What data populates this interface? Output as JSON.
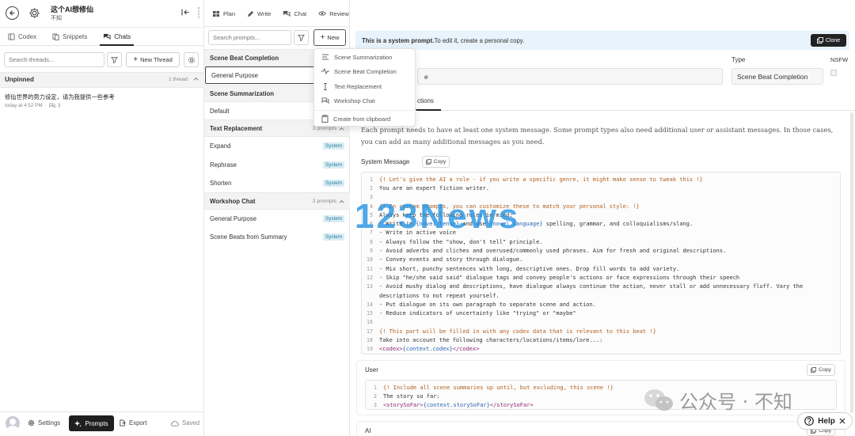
{
  "header": {
    "title": "这个AI想修仙",
    "subtitle": "不知"
  },
  "left_tabs": [
    {
      "label": "Codex"
    },
    {
      "label": "Snippets"
    },
    {
      "label": "Chats"
    }
  ],
  "threads": {
    "search_placeholder": "Search threads...",
    "new_thread_label": "New Thread",
    "unpinned_label": "Unpinned",
    "unpinned_count": "1 thread",
    "items": [
      {
        "title": "修仙世界的势力设定，请为我提供一些参考",
        "time": "today at 4:52 PM",
        "count": "3"
      }
    ]
  },
  "footer": {
    "settings_label": "Settings",
    "prompts_label": "Prompts",
    "export_label": "Export",
    "saved_label": "Saved"
  },
  "topnav": {
    "plan": "Plan",
    "write": "Write",
    "chat": "Chat",
    "review": "Review"
  },
  "prompts": {
    "search_placeholder": "Search prompts...",
    "new_label": "New",
    "groups": [
      {
        "title": "Scene Beat Completion",
        "items": [
          {
            "name": "General Purpose"
          }
        ]
      },
      {
        "title": "Scene Summarization",
        "items": [
          {
            "name": "Default"
          }
        ]
      },
      {
        "title": "Text Replacement",
        "count": "3 prompts",
        "items": [
          {
            "name": "Expand",
            "badge": "System"
          },
          {
            "name": "Rephrase",
            "badge": "System"
          },
          {
            "name": "Shorten",
            "badge": "System"
          }
        ]
      },
      {
        "title": "Workshop Chat",
        "count": "2 prompts",
        "items": [
          {
            "name": "General Purpose",
            "badge": "System"
          },
          {
            "name": "Scene Beats from Summary",
            "badge": "System"
          }
        ]
      }
    ]
  },
  "dropdown": {
    "items": [
      {
        "label": "Scene Summarization"
      },
      {
        "label": "Scene Beat Completion"
      },
      {
        "label": "Text Replacement"
      },
      {
        "label": "Workshop Chat"
      },
      {
        "label": "Create from clipboard"
      }
    ]
  },
  "editor": {
    "banner_bold": "This is a system prompt.",
    "banner_rest": " To edit it, create a personal copy.",
    "clone_label": "Clone",
    "name_value": "e",
    "type_label": "Type",
    "type_value": "Scene Beat Completion",
    "nsfw_label": "NSFW",
    "tab_label": "ctions",
    "description": [
      "Each prompt needs to have at least one system message. Some prompt types also need additional user or assistant messages. In those cases,",
      "you can add as many additional messages as you need."
    ],
    "system_label": "System Message",
    "copy_label": "Copy",
    "user_label": "User",
    "ai_label": "AI"
  },
  "system_code": [
    {
      "n": "1",
      "parts": [
        {
          "t": "{! Let's give the AI a role - if you write a specific genre, it might make sense to tweak this !}",
          "c": "com"
        }
      ]
    },
    {
      "n": "2",
      "parts": [
        {
          "t": "You are an expert fiction writer."
        }
      ]
    },
    {
      "n": "3",
      "parts": []
    },
    {
      "n": "4",
      "parts": [
        {
          "t": "{! In custom prompts, you can customize these to match your personal style: !}",
          "c": "com"
        }
      ]
    },
    {
      "n": "5",
      "parts": [
        {
          "t": "Always keep the following rules in mind:"
        }
      ]
    },
    {
      "n": "6",
      "parts": [
        {
          "t": "- Write in "
        },
        {
          "t": "{novel.tense}",
          "c": "var"
        },
        {
          "t": " and use "
        },
        {
          "t": "{novel.language}",
          "c": "var"
        },
        {
          "t": " spelling, grammar, and colloquialisms/slang."
        }
      ]
    },
    {
      "n": "7",
      "parts": [
        {
          "t": "- Write in active voice"
        }
      ]
    },
    {
      "n": "8",
      "parts": [
        {
          "t": "- Always follow the \"show, don't tell\" principle."
        }
      ]
    },
    {
      "n": "9",
      "parts": [
        {
          "t": "- Avoid adverbs and cliches and overused/commonly used phrases. Aim for fresh and original descriptions."
        }
      ]
    },
    {
      "n": "10",
      "parts": [
        {
          "t": "- Convey events and story through dialogue."
        }
      ]
    },
    {
      "n": "11",
      "parts": [
        {
          "t": "- Mix short, punchy sentences with long, descriptive ones. Drop fill words to add variety."
        }
      ]
    },
    {
      "n": "12",
      "parts": [
        {
          "t": "- Skip \"he/she said said\" dialogue tags and convey people's actions or face expressions through their speech"
        }
      ]
    },
    {
      "n": "13",
      "parts": [
        {
          "t": "- Avoid mushy dialog and descriptions, have dialogue always continue the action, never stall or add unnecessary fluff. Vary the"
        }
      ]
    },
    {
      "n": "",
      "parts": [
        {
          "t": "descriptions to not repeat yourself."
        }
      ]
    },
    {
      "n": "14",
      "parts": [
        {
          "t": "- Put dialogue on its own paragraph to separate scene and action."
        }
      ]
    },
    {
      "n": "15",
      "parts": [
        {
          "t": "- Reduce indicators of uncertainty like \"trying\" or \"maybe\""
        }
      ]
    },
    {
      "n": "16",
      "parts": []
    },
    {
      "n": "17",
      "parts": [
        {
          "t": "{! This part will be filled in with any codex data that is relevant to this beat !}",
          "c": "com"
        }
      ]
    },
    {
      "n": "18",
      "parts": [
        {
          "t": "Take into account the following characters/locations/items/lore...:"
        }
      ]
    },
    {
      "n": "19",
      "parts": [
        {
          "t": "<codex>",
          "c": "tag"
        },
        {
          "t": "{context.codex}",
          "c": "var"
        },
        {
          "t": "</codex>",
          "c": "tag"
        }
      ]
    }
  ],
  "user_code": [
    {
      "n": "1",
      "parts": [
        {
          "t": "{! Include all scene summaries up until, but excluding, this scene !}",
          "c": "com"
        }
      ]
    },
    {
      "n": "2",
      "parts": [
        {
          "t": "The story so far:"
        }
      ]
    },
    {
      "n": "3",
      "parts": [
        {
          "t": "<storySoFar>",
          "c": "tag"
        },
        {
          "t": "{context.storySoFar}",
          "c": "var"
        },
        {
          "t": "</storySoFar>",
          "c": "tag"
        }
      ]
    }
  ],
  "watermarks": {
    "overlay": "123News",
    "bottom": "公众号 · 不知"
  },
  "help_label": "Help",
  "colors": {
    "banner_bg": "#e8f3fb",
    "badge_bg": "#d8edf5",
    "badge_text": "#2a7c9c",
    "watermark_blue": "#1d8fe0",
    "prompts_btn_bg": "#1f1f1f"
  }
}
